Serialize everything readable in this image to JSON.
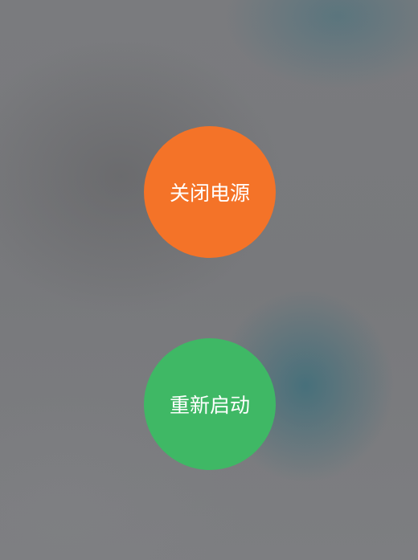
{
  "power_menu": {
    "power_off_label": "关闭电源",
    "restart_label": "重新启动"
  },
  "colors": {
    "power_off": "#f47328",
    "restart": "#3fb865",
    "backdrop": "#7c7d80",
    "label_text": "#ffffff"
  }
}
